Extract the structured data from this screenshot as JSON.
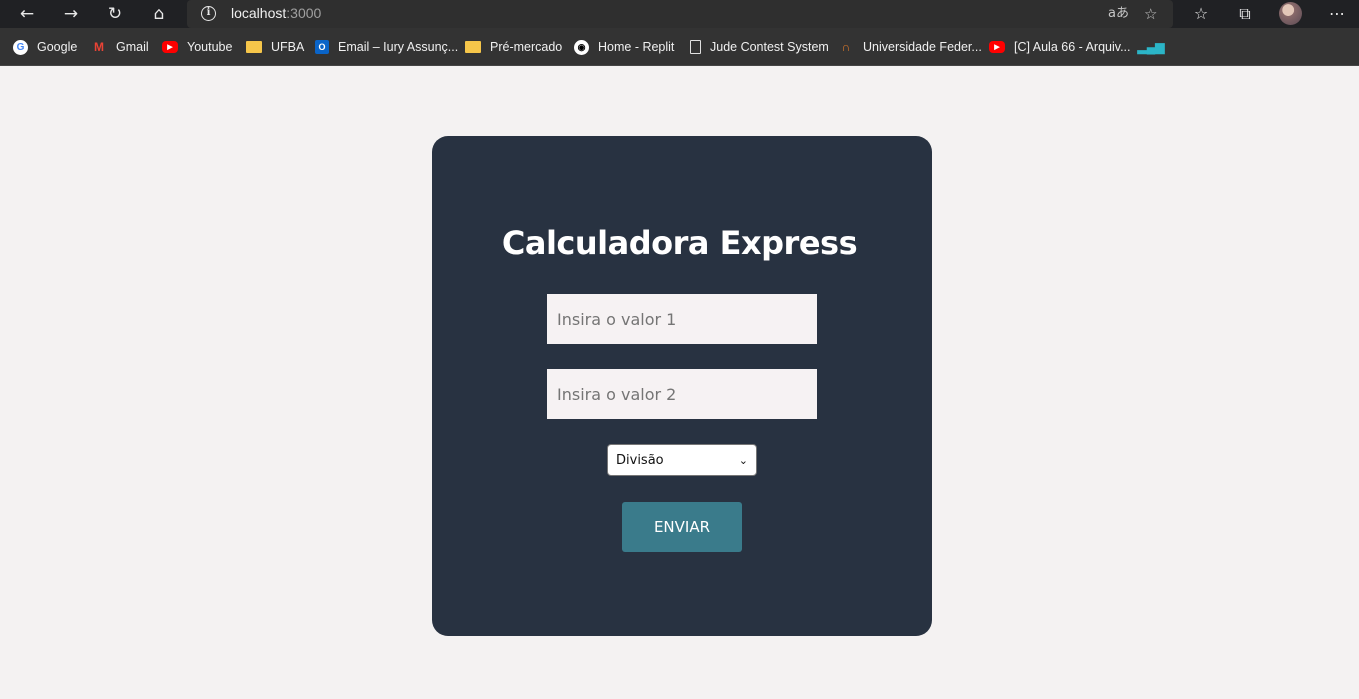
{
  "browser": {
    "url_host": "localhost",
    "url_port": ":3000",
    "nav_icons": [
      "back-icon",
      "forward-icon",
      "refresh-icon",
      "home-icon"
    ],
    "right_icons": [
      "read-aloud-icon",
      "add-favorite-icon",
      "favorites-icon",
      "collections-icon",
      "profile-avatar",
      "more-icon"
    ]
  },
  "bookmarks": [
    {
      "label": "Google",
      "icon": "google-icon"
    },
    {
      "label": "Gmail",
      "icon": "gmail-icon"
    },
    {
      "label": "Youtube",
      "icon": "youtube-icon"
    },
    {
      "label": "UFBA",
      "icon": "folder-icon"
    },
    {
      "label": "Email – Iury Assunç...",
      "icon": "outlook-icon"
    },
    {
      "label": "Pré-mercado",
      "icon": "folder-icon"
    },
    {
      "label": "Home - Replit",
      "icon": "replit-icon"
    },
    {
      "label": "Jude Contest System",
      "icon": "document-icon"
    },
    {
      "label": "Universidade Feder...",
      "icon": "ufba-icon"
    },
    {
      "label": "[C] Aula 66 - Arquiv...",
      "icon": "youtube-icon"
    },
    {
      "label": "",
      "icon": "chart-icon"
    }
  ],
  "page": {
    "title": "Calculadora Express",
    "input1_placeholder": "Insira o valor 1",
    "input2_placeholder": "Insira o valor 2",
    "operation_selected": "Divisão",
    "submit_label": "ENVIAR"
  },
  "colors": {
    "page_bg": "#f4f2f2",
    "card_bg": "#283241",
    "button_bg": "#3a7b8b",
    "input_bg": "#f6f2f3"
  }
}
